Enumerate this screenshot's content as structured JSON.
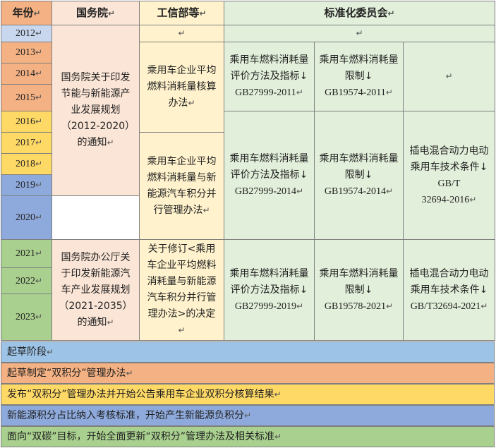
{
  "header": {
    "year": "年份",
    "state_council": "国务院",
    "miit": "工信部等",
    "standards": "标准化委员会"
  },
  "years": [
    "2012",
    "2013",
    "2014",
    "2015",
    "2016",
    "2017",
    "2018",
    "2019",
    "2020",
    "2021",
    "2022",
    "2023"
  ],
  "state_council_docs": {
    "doc1": "国务院关于印发节能与新能源产业发展规划（2012-2020）的通知",
    "doc2": "国务院办公厅关于印发新能源汽车产业发展规划（2021-2035）的通知"
  },
  "miit_docs": {
    "doc1": "乘用车企业平均燃料消耗量核算办法",
    "doc2": "乘用车企业平均燃料消耗量与新能源汽车积分并行管理办法",
    "doc3": "关于修订<乘用车企业平均燃料消耗量与新能源汽车积分并行管理办法>的决定"
  },
  "standards_docs": {
    "eval_method": "乘用车燃料消耗量评价方法及指标",
    "limit": "乘用车燃料消耗量限制",
    "phev": "插电混合动力电动乘用车技术条件",
    "gb27999_2011": "GB27999-2011",
    "gb19574_2011": "GB19574-2011",
    "gb27999_2014": "GB27999-2014",
    "gb19574_2014": "GB19574-2014",
    "gbt_prefix": "GB/T",
    "gbt_32694_2016": "32694-2016",
    "gb27999_2019": "GB27999-2019",
    "gb19578_2021": "GB19578-2021",
    "gbt32694_2021": "GB/T32694-2021"
  },
  "marks": {
    "ret": "↵",
    "arrow": "↓"
  },
  "legend": [
    {
      "text": "起草阶段",
      "color": "#9dc3e6"
    },
    {
      "text": "起草制定“双积分”管理办法",
      "color": "#f4b183"
    },
    {
      "text": "发布“双积分”管理办法并开始公告乘用车企业双积分核算结果",
      "color": "#ffd966"
    },
    {
      "text": "新能源积分占比纳入考核标准，开始产生新能源负积分",
      "color": "#8eaadc"
    },
    {
      "text": "面向“双碳”目标，开始全面更新“双积分”管理办法及相关标准",
      "color": "#a9d08e"
    }
  ]
}
